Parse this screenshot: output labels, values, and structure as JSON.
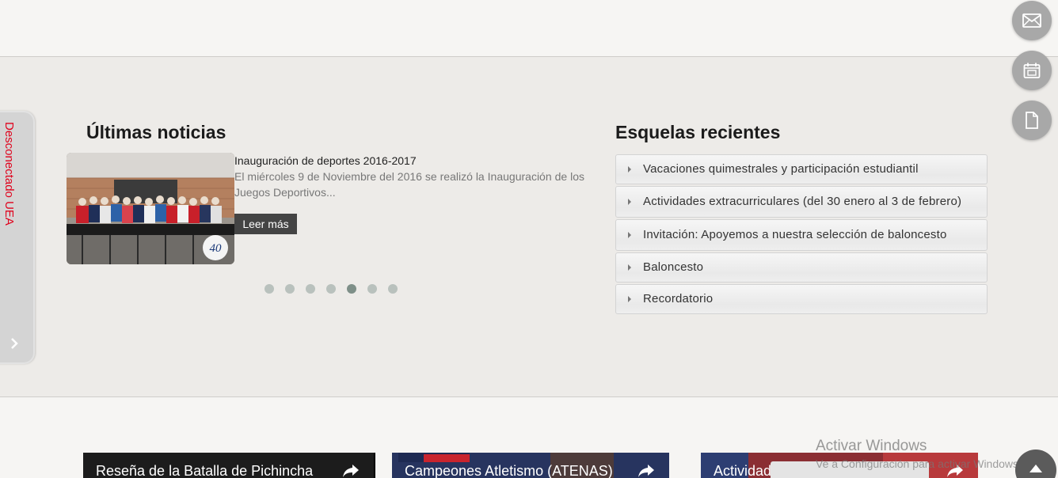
{
  "side_tab": {
    "label": "Desconectado UEA",
    "arrow_icon": "chevron-right-icon"
  },
  "floating_buttons": [
    {
      "icon": "envelope-icon"
    },
    {
      "icon": "calendar-icon"
    },
    {
      "icon": "document-icon"
    }
  ],
  "news": {
    "heading": "Últimas noticias",
    "item": {
      "title": "Inauguración de deportes 2016-2017",
      "excerpt": "El miércoles 9 de Noviembre del 2016 se realizó la Inauguración de los Juegos Deportivos...",
      "read_more": "Leer más",
      "photo_badge": "40"
    },
    "carousel": {
      "total": 7,
      "active_index": 5
    }
  },
  "notices": {
    "heading": "Esquelas recientes",
    "items": [
      {
        "label": "Vacaciones quimestrales y participación estudiantil"
      },
      {
        "label": "Actividades extracurriculares (del 30 enero al 3 de febrero)"
      },
      {
        "label": "Invitación: Apoyemos a nuestra selección de baloncesto"
      },
      {
        "label": "Baloncesto"
      },
      {
        "label": "Recordatorio"
      }
    ]
  },
  "videos": [
    {
      "title": "Reseña de la Batalla de Pichincha",
      "icon": "share-icon"
    },
    {
      "title": "Campeones Atletismo (ATENAS)",
      "icon": "share-icon"
    },
    {
      "title": "Actividad",
      "icon": "share-icon"
    }
  ],
  "windows_watermark": {
    "title": "Activar Windows",
    "subtitle": "Ve a Configuración para activar Windows."
  },
  "scroll_top": {
    "icon": "arrow-up-icon"
  }
}
